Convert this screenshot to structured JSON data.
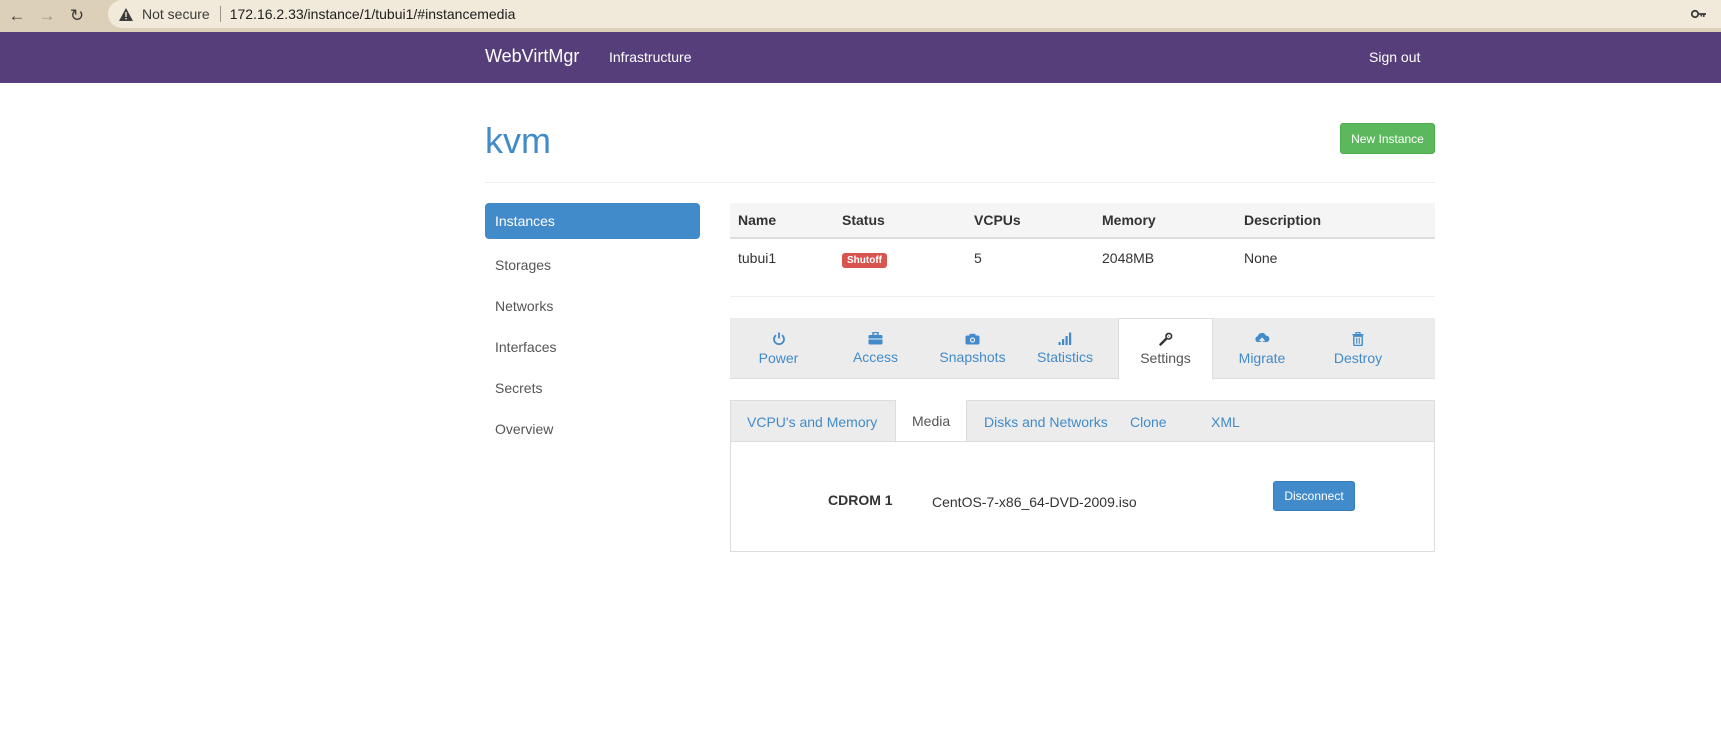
{
  "browser": {
    "security_label": "Not secure",
    "url": "172.16.2.33/instance/1/tubui1/#instancemedia"
  },
  "navbar": {
    "brand": "WebVirtMgr",
    "infrastructure": "Infrastructure",
    "sign_out": "Sign out"
  },
  "header": {
    "title": "kvm",
    "new_instance": "New Instance"
  },
  "sidebar": {
    "items": [
      {
        "label": "Instances",
        "active": true
      },
      {
        "label": "Storages"
      },
      {
        "label": "Networks"
      },
      {
        "label": "Interfaces"
      },
      {
        "label": "Secrets"
      },
      {
        "label": "Overview"
      }
    ]
  },
  "table": {
    "columns": [
      "Name",
      "Status",
      "VCPUs",
      "Memory",
      "Description"
    ],
    "row": {
      "name": "tubui1",
      "status": "Shutoff",
      "vcpus": "5",
      "memory": "2048MB",
      "description": "None"
    }
  },
  "action_tabs": [
    {
      "label": "Power",
      "icon": "power-icon"
    },
    {
      "label": "Access",
      "icon": "briefcase-icon"
    },
    {
      "label": "Snapshots",
      "icon": "camera-icon"
    },
    {
      "label": "Statistics",
      "icon": "signal-icon"
    },
    {
      "label": "Settings",
      "icon": "wrench-icon",
      "active": true
    },
    {
      "label": "Migrate",
      "icon": "cloud-upload-icon"
    },
    {
      "label": "Destroy",
      "icon": "trash-icon"
    }
  ],
  "sub_tabs": [
    {
      "label": "VCPU's and Memory"
    },
    {
      "label": "Media",
      "active": true
    },
    {
      "label": "Disks and Networks"
    },
    {
      "label": "Clone"
    },
    {
      "label": "XML"
    }
  ],
  "media": {
    "cdrom_label": "CDROM 1",
    "cdrom_value": "CentOS-7-x86_64-DVD-2009.iso",
    "disconnect": "Disconnect"
  },
  "colors": {
    "navbar": "#553e7a",
    "primary": "#428bca",
    "success": "#5cb85c",
    "danger": "#d9534f"
  }
}
